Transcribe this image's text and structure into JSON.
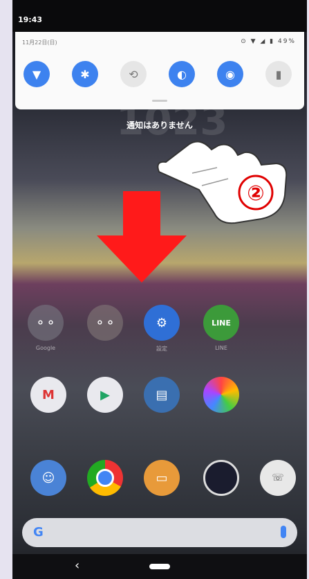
{
  "status": {
    "time": "19:43"
  },
  "quick_settings": {
    "date": "11月22日(日)",
    "system_icons": "⊙ ▼ ◢ ▮ 49%",
    "tiles": [
      {
        "name": "wifi",
        "active": true
      },
      {
        "name": "bluetooth",
        "active": true
      },
      {
        "name": "auto-rotate",
        "active": false
      },
      {
        "name": "data-saver",
        "active": true
      },
      {
        "name": "location",
        "active": true
      },
      {
        "name": "flashlight",
        "active": false
      }
    ]
  },
  "notification_text": "通知はありません",
  "watermark": "1023",
  "annotation": {
    "step": "②",
    "arrow_color": "#ff1a1a"
  },
  "apps": {
    "row1": [
      "Google",
      "",
      "設定",
      "LINE"
    ],
    "row2": [
      "",
      "",
      "",
      ""
    ],
    "dock": [
      "",
      "",
      "",
      "",
      ""
    ]
  },
  "search": {
    "logo": "G"
  },
  "colors": {
    "accent": "#3d82ef",
    "arrow": "#ff1a1a"
  }
}
